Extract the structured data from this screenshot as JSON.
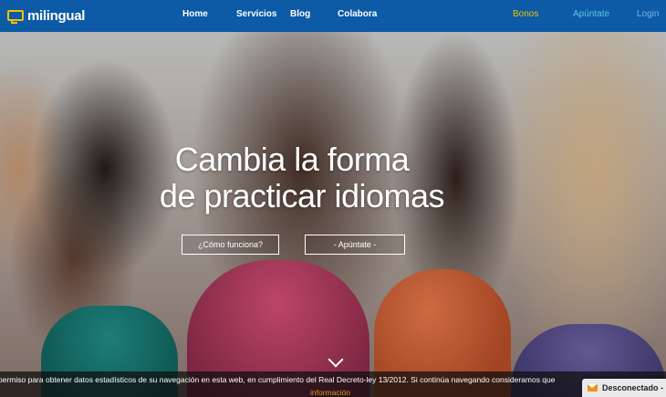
{
  "header": {
    "logo_text": "milingual",
    "nav": {
      "home": "Home",
      "servicios": "Servicios",
      "blog": "Blog",
      "colabora": "Colabora",
      "bonos": "Bonos",
      "apuntate": "Apúntate",
      "login": "Login"
    },
    "colors": {
      "bar": "#0d5aa6",
      "bonos": "#f2c200",
      "apuntate": "#5fc7df",
      "login": "#7fb2e6"
    }
  },
  "hero": {
    "headline_line1": "Cambia la forma",
    "headline_line2": "de practicar idiomas",
    "cta_how": "¿Cómo funciona?",
    "cta_signup": "- Apúntate -",
    "scroll_icon": "chevron-down-icon"
  },
  "cookie_bar": {
    "text": "permiso para obtener datos estadísticos de su navegación en esta web, en cumplimiento del Real Decreto-ley 13/2012. Si continúa navegando consideramos que",
    "link": "información"
  },
  "chat": {
    "icon": "mail-icon",
    "status": "Desconectado -"
  }
}
